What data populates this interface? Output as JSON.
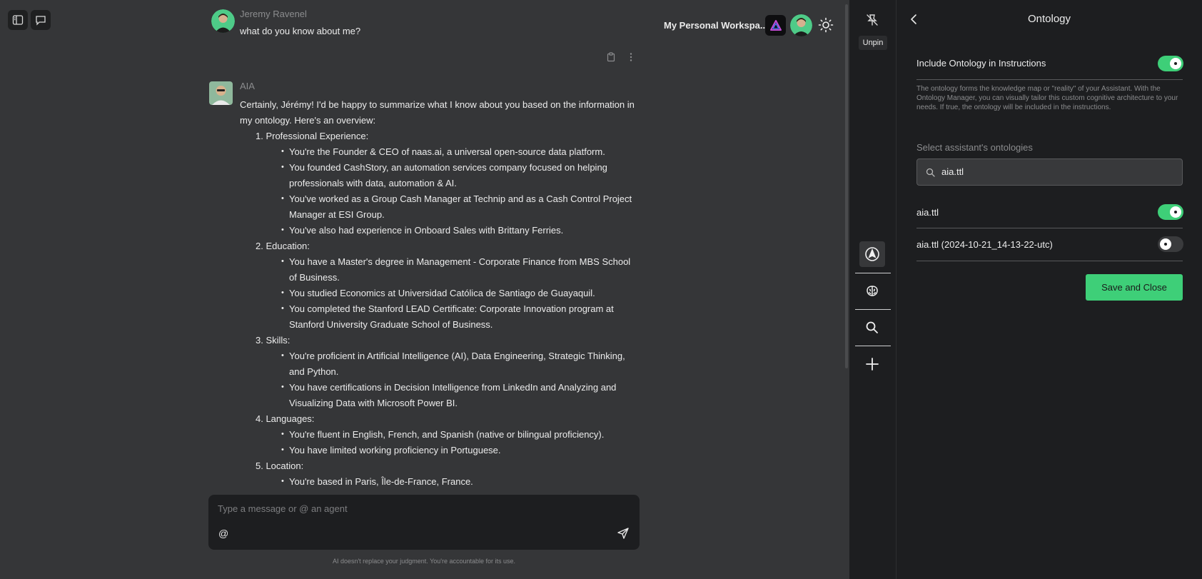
{
  "top_left": {
    "sidebar_toggle_icon": "sidebar-icon",
    "new_chat_icon": "chat-icon"
  },
  "header": {
    "workspace_label": "My Personal Workspa...",
    "theme_icon": "sun-icon"
  },
  "chat": {
    "user_message": {
      "sender": "Jeremy Ravenel",
      "text": "what do you know about me?"
    },
    "assistant_message": {
      "sender": "AIA",
      "intro": "Certainly, Jérémy! I'd be happy to summarize what I know about you based on the information in my ontology. Here's an overview:",
      "sections": [
        {
          "title": "1. Professional Experience:",
          "items": [
            "You're the Founder & CEO of naas.ai, a universal open-source data platform.",
            "You founded CashStory, an automation services company focused on helping professionals with data, automation & AI.",
            "You've worked as a Group Cash Manager at Technip and as a Cash Control Project Manager at ESI Group.",
            "You've also had experience in Onboard Sales with Brittany Ferries."
          ]
        },
        {
          "title": "2. Education:",
          "items": [
            "You have a Master's degree in Management - Corporate Finance from MBS School of Business.",
            "You studied Economics at Universidad Católica de Santiago de Guayaquil.",
            "You completed the Stanford LEAD Certificate: Corporate Innovation program at Stanford University Graduate School of Business."
          ]
        },
        {
          "title": "3. Skills:",
          "items": [
            "You're proficient in Artificial Intelligence (AI), Data Engineering, Strategic Thinking, and Python.",
            "You have certifications in Decision Intelligence from LinkedIn and Analyzing and Visualizing Data with Microsoft Power BI."
          ]
        },
        {
          "title": "4. Languages:",
          "items": [
            "You're fluent in English, French, and Spanish (native or bilingual proficiency).",
            "You have limited working proficiency in Portuguese."
          ]
        },
        {
          "title": "5. Location:",
          "items": [
            "You're based in Paris, Île-de-France, France."
          ]
        }
      ]
    }
  },
  "composer": {
    "placeholder": "Type a message or @ an agent",
    "mention_label": "@",
    "disclaimer": "AI doesn't replace your judgment. You're accountable for its use."
  },
  "rail": {
    "unpin_label": "Unpin",
    "icons": [
      "compass-icon",
      "brain-icon",
      "search-icon",
      "plus-icon"
    ]
  },
  "panel": {
    "title": "Ontology",
    "include_label": "Include Ontology in Instructions",
    "include_on": true,
    "description": "The ontology forms the knowledge map or \"reality\" of your Assistant. With the Ontology Manager, you can visually tailor this custom cognitive architecture to your needs. If true, the ontology will be included in the instructions.",
    "select_label": "Select assistant's ontologies",
    "search_value": "aia.ttl",
    "ontologies": [
      {
        "name": "aia.ttl",
        "enabled": true
      },
      {
        "name": "aia.ttl (2024-10-21_14-13-22-utc)",
        "enabled": false
      }
    ],
    "save_label": "Save and Close"
  },
  "colors": {
    "background": "#353638",
    "panel": "#1d1e20",
    "accent": "#3ecf78"
  }
}
